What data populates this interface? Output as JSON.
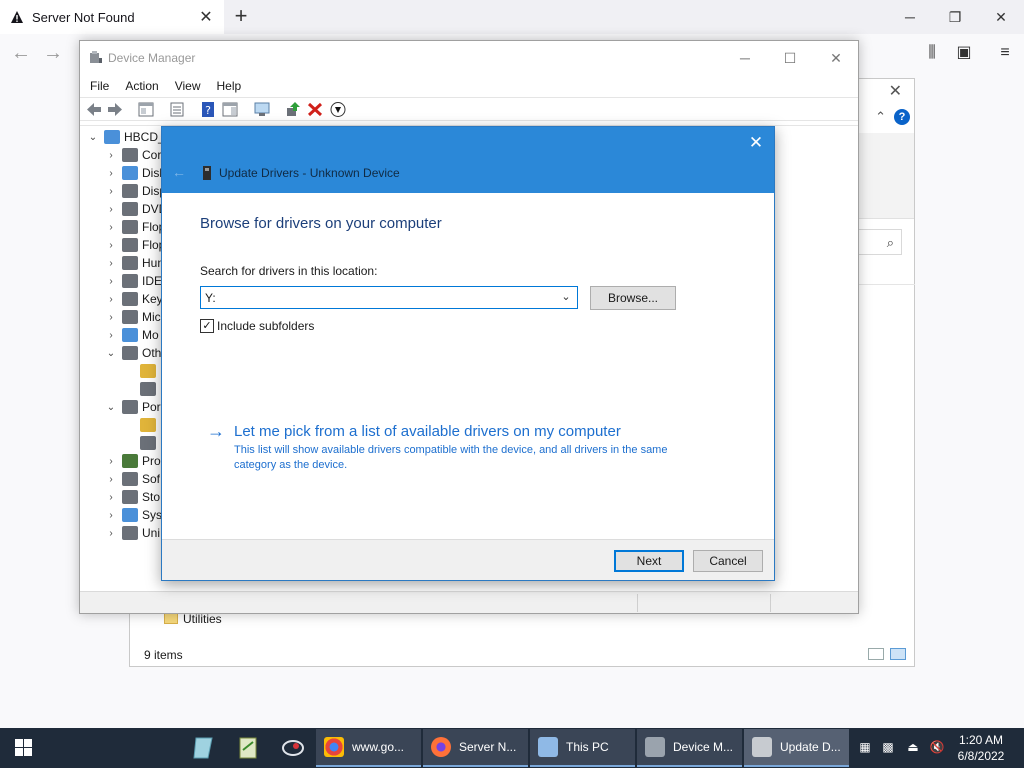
{
  "browser": {
    "tab_title": "Server Not Found",
    "new_tab": "+",
    "win_min": "─",
    "win_max": "❐",
    "win_close": "✕"
  },
  "explorer": {
    "folder_label": "Utilities",
    "status": "9 items"
  },
  "devmgr": {
    "title": "Device Manager",
    "menu": [
      "File",
      "Action",
      "View",
      "Help"
    ],
    "tree": [
      {
        "exp": "⌄",
        "label": "HBCD_",
        "indent": 0
      },
      {
        "exp": "›",
        "label": "Cor",
        "indent": 1
      },
      {
        "exp": "›",
        "label": "Disl",
        "indent": 1
      },
      {
        "exp": "›",
        "label": "Disp",
        "indent": 1
      },
      {
        "exp": "›",
        "label": "DVD",
        "indent": 1
      },
      {
        "exp": "›",
        "label": "Flop",
        "indent": 1
      },
      {
        "exp": "›",
        "label": "Flop",
        "indent": 1
      },
      {
        "exp": "›",
        "label": "Hun",
        "indent": 1
      },
      {
        "exp": "›",
        "label": "IDE",
        "indent": 1
      },
      {
        "exp": "›",
        "label": "Key",
        "indent": 1
      },
      {
        "exp": "›",
        "label": "Mic",
        "indent": 1
      },
      {
        "exp": "›",
        "label": "Mo",
        "indent": 1
      },
      {
        "exp": "⌄",
        "label": "Oth",
        "indent": 1
      },
      {
        "exp": "",
        "label": "",
        "indent": 2
      },
      {
        "exp": "",
        "label": "",
        "indent": 2
      },
      {
        "exp": "⌄",
        "label": "Por",
        "indent": 1
      },
      {
        "exp": "",
        "label": "",
        "indent": 2
      },
      {
        "exp": "",
        "label": "",
        "indent": 2
      },
      {
        "exp": "›",
        "label": "Pro",
        "indent": 1
      },
      {
        "exp": "›",
        "label": "Sof",
        "indent": 1
      },
      {
        "exp": "›",
        "label": "Sto",
        "indent": 1
      },
      {
        "exp": "›",
        "label": "Syst",
        "indent": 1
      },
      {
        "exp": "›",
        "label": "Uni",
        "indent": 1
      }
    ]
  },
  "dialog": {
    "title": "Update Drivers - Unknown Device",
    "close": "✕",
    "heading": "Browse for drivers on your computer",
    "search_label": "Search for drivers in this location:",
    "search_value": "Y:",
    "browse_label": "Browse...",
    "include_label": "Include subfolders",
    "include_checked": true,
    "pick_arrow": "→",
    "pick_title": "Let me pick from a list of available drivers on my computer",
    "pick_desc": "This list will show available drivers compatible with the device, and all drivers in the same category as the device.",
    "next_label": "Next",
    "cancel_label": "Cancel"
  },
  "taskbar": {
    "items": [
      {
        "label": "www.go...",
        "icon": "chrome-icon",
        "color": "#e8453c"
      },
      {
        "label": "Server N...",
        "icon": "firefox-icon",
        "color": "#ff7139"
      },
      {
        "label": "This PC",
        "icon": "this-pc-icon",
        "color": "#8fb9e6"
      },
      {
        "label": "Device M...",
        "icon": "device-manager-icon",
        "color": "#9aa3ad"
      },
      {
        "label": "Update D...",
        "icon": "update-drivers-icon",
        "color": "#c7cbd0"
      }
    ],
    "time": "1:20 AM",
    "date": "6/8/2022"
  },
  "colors": {
    "dialog_header": "#2b88d8",
    "link_blue": "#1d6fcf",
    "heading_blue": "#1c3f7a",
    "taskbar": "#1f2b3a"
  }
}
